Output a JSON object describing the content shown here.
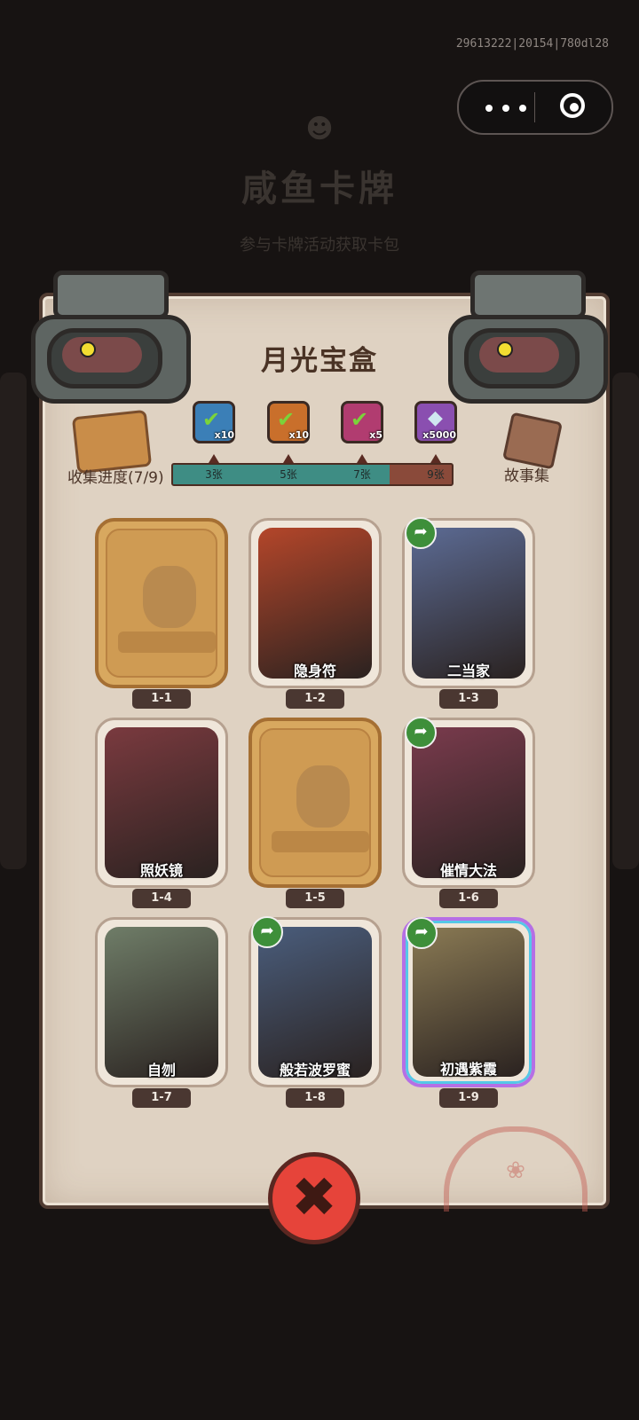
{
  "background": {
    "title": "咸鱼卡牌",
    "subtitle": "参与卡牌活动获取卡包"
  },
  "system": {
    "build_info": "29613222|20154|780dl28",
    "capsule_more_icon": "more-dots-icon",
    "capsule_close_icon": "target-icon"
  },
  "panel": {
    "title": "月光宝盒",
    "collect_label": "收集进度(7/9)",
    "story_label": "故事集",
    "progress": {
      "current": 7,
      "total": 9
    },
    "milestones": [
      {
        "label": "3张",
        "reward_qty": "x10",
        "reward_color": "#3b7fb7",
        "claimed": true
      },
      {
        "label": "5张",
        "reward_qty": "x10",
        "reward_color": "#c96f2b",
        "claimed": true
      },
      {
        "label": "7张",
        "reward_qty": "x5",
        "reward_color": "#b13c70",
        "claimed": true
      },
      {
        "label": "9张",
        "reward_qty": "x5000",
        "reward_color": "#8a4fb0",
        "claimed": false
      }
    ],
    "cards": [
      {
        "id": "1-1",
        "title": "",
        "owned": false,
        "shared": false,
        "art_color": ""
      },
      {
        "id": "1-2",
        "title": "隐身符",
        "owned": true,
        "shared": false,
        "art_color": "#b4462a"
      },
      {
        "id": "1-3",
        "title": "二当家",
        "owned": true,
        "shared": true,
        "art_color": "#5c6b94"
      },
      {
        "id": "1-4",
        "title": "照妖镜",
        "owned": true,
        "shared": false,
        "art_color": "#7a3a3f"
      },
      {
        "id": "1-5",
        "title": "",
        "owned": false,
        "shared": false,
        "art_color": ""
      },
      {
        "id": "1-6",
        "title": "催情大法",
        "owned": true,
        "shared": true,
        "art_color": "#7a3b4d"
      },
      {
        "id": "1-7",
        "title": "自刎",
        "owned": true,
        "shared": false,
        "art_color": "#6f7d68"
      },
      {
        "id": "1-8",
        "title": "般若波罗蜜",
        "owned": true,
        "shared": true,
        "art_color": "#4a5d7c"
      },
      {
        "id": "1-9",
        "title": "初遇紫霞",
        "owned": true,
        "shared": true,
        "art_color": "#8a7a54"
      }
    ],
    "close_icon": "close-x-icon"
  }
}
